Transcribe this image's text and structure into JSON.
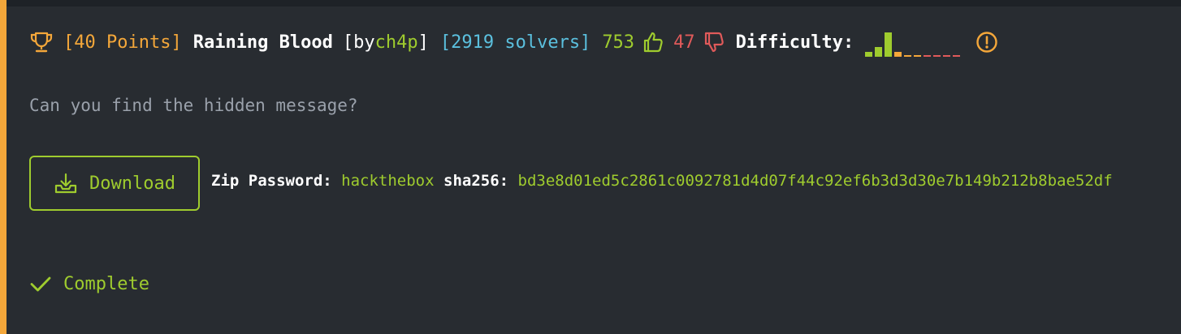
{
  "challenge": {
    "points_label": "[40 Points]",
    "name": "Raining Blood",
    "by_prefix": "[by ",
    "author": "ch4p",
    "by_suffix": "]",
    "solvers_label": "[2919 solvers]",
    "likes": "753",
    "dislikes": "47",
    "difficulty_label": "Difficulty:",
    "difficulty_votes": [
      1,
      2,
      5,
      1,
      0.3,
      0.3,
      0.1,
      0.1,
      0.1,
      0.1
    ],
    "description": "Can you find the hidden message?",
    "download_label": "Download",
    "zip_password_label": "Zip Password:",
    "zip_password": "hackthebox",
    "sha_label": "sha256:",
    "sha256": "bd3e8d01ed5c2861c0092781d4d07f44c92ef6b3d3d30e7b149b212b8bae52df",
    "status": "Complete"
  },
  "colors": {
    "accent": "#f4a73a",
    "green": "#9fcc2e",
    "blue": "#5bc0de",
    "red": "#e05a5a",
    "muted": "#9aa1ab",
    "background": "#282c31"
  },
  "icons": [
    "trophy-icon",
    "thumbs-up-icon",
    "thumbs-down-icon",
    "info-icon",
    "download-icon",
    "check-icon"
  ]
}
